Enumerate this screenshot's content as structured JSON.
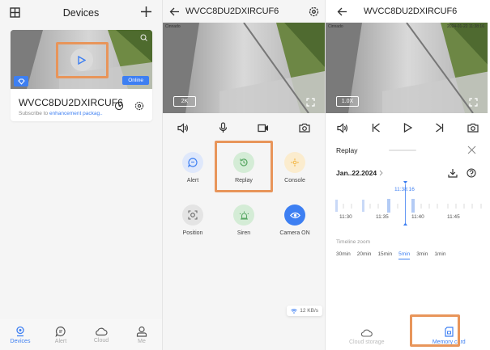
{
  "colors": {
    "accent": "#3d7ff2",
    "highlight": "#e8955a",
    "replay_green": "#5aa865",
    "console_yellow": "#f3b84a"
  },
  "devices_screen": {
    "title": "Devices",
    "card": {
      "device_name": "WVCC8DU2DXIRCUF6",
      "subscribe_prefix": "Subscribe to ",
      "subscribe_link": "enhancement packag..",
      "status": "Online"
    },
    "nav": [
      {
        "label": "Devices",
        "icon": "camera-icon",
        "active": true
      },
      {
        "label": "Alert",
        "icon": "chat-icon",
        "active": false
      },
      {
        "label": "Cloud",
        "icon": "cloud-icon",
        "active": false
      },
      {
        "label": "Me",
        "icon": "person-icon",
        "active": false
      }
    ]
  },
  "live_screen": {
    "title": "WVCC8DU2DXIRCUF6",
    "video_tag": "Cinnado",
    "resolution": "2K",
    "features": [
      {
        "label": "Alert",
        "icon": "message-icon"
      },
      {
        "label": "Replay",
        "icon": "history-icon"
      },
      {
        "label": "Console",
        "icon": "dpad-icon"
      },
      {
        "label": "Position",
        "icon": "position-icon"
      },
      {
        "label": "Siren",
        "icon": "siren-icon"
      },
      {
        "label": "Camera ON",
        "icon": "eye-icon"
      }
    ],
    "speed": "12 KB/s"
  },
  "replay_screen": {
    "title": "WVCC8DU2DXIRCUF6",
    "video_tag": "Cinnado",
    "video_timestamp": "2024-01-22 11:38:16",
    "zoom": "1.0X",
    "replay_label": "Replay",
    "date": "Jan..22.2024",
    "current_time": "11:38:16",
    "ticks": [
      "11:30",
      "11:35",
      "11:40",
      "11:45"
    ],
    "timeline_zoom_label": "Timeline zoom",
    "zoom_options": [
      {
        "label": "30min",
        "selected": false
      },
      {
        "label": "20min",
        "selected": false
      },
      {
        "label": "15min",
        "selected": false
      },
      {
        "label": "5min",
        "selected": true
      },
      {
        "label": "3min",
        "selected": false
      },
      {
        "label": "1min",
        "selected": false
      }
    ],
    "tabs": [
      {
        "label": "Cloud storage",
        "icon": "cloud-icon",
        "active": false
      },
      {
        "label": "Memory card",
        "icon": "sd-card-icon",
        "active": true
      }
    ]
  }
}
